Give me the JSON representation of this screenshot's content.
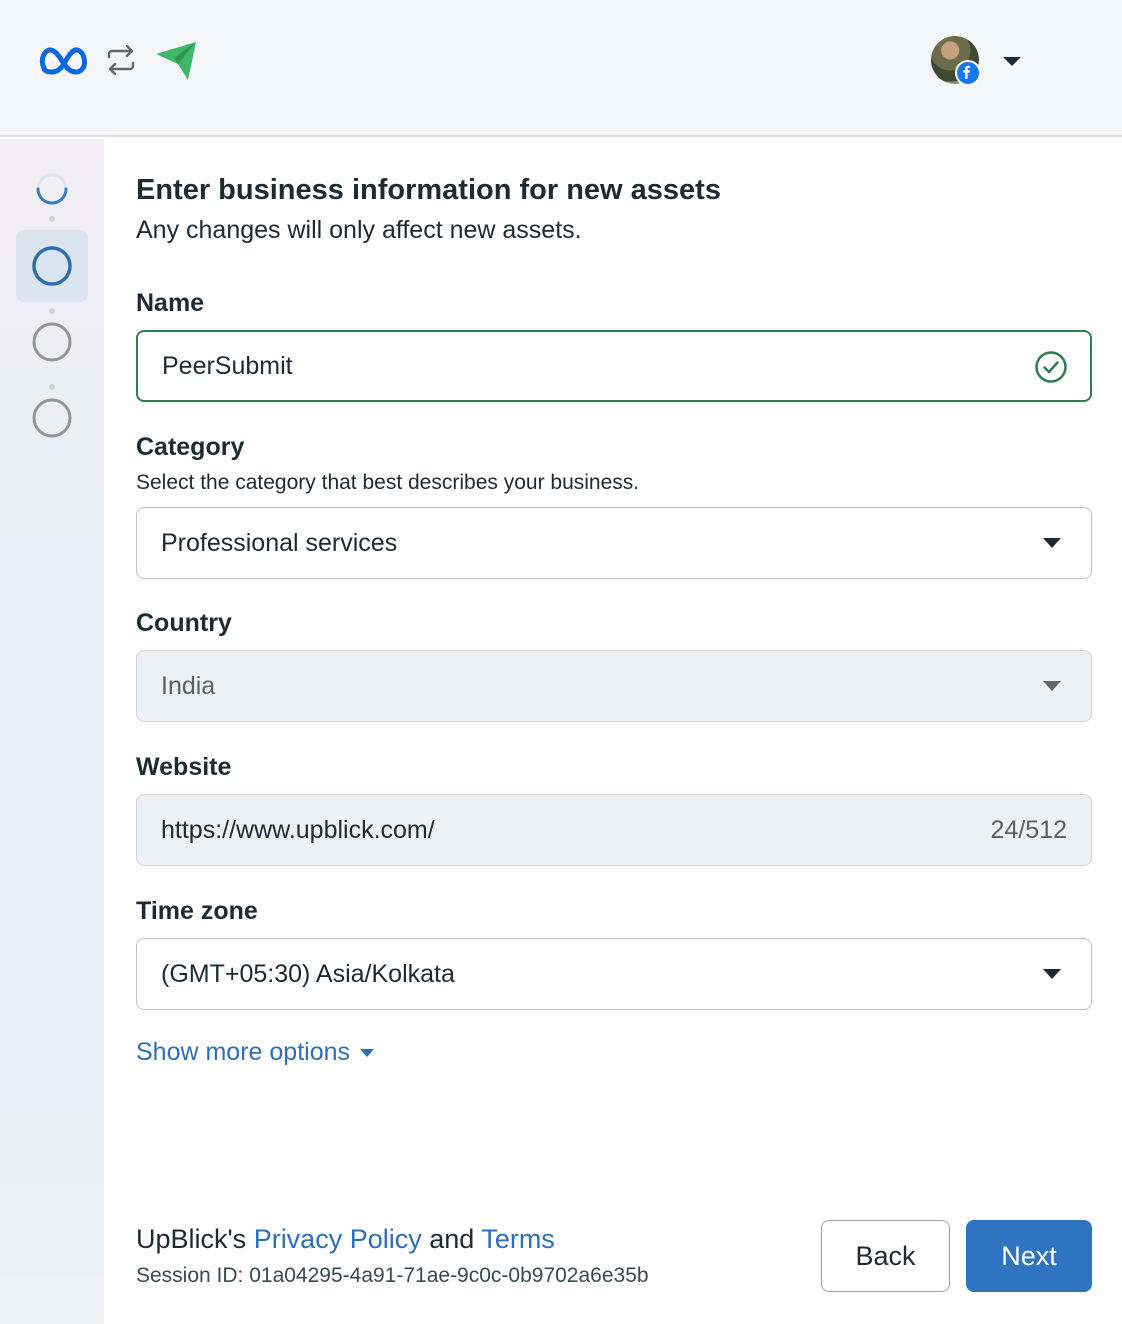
{
  "header": {
    "logos": [
      "meta-logo",
      "sync-icon",
      "app-logo"
    ],
    "account_menu_icon": "chevron-down-icon"
  },
  "stepper": {
    "steps": [
      "loading-step",
      "current-step",
      "pending-step",
      "pending-step"
    ]
  },
  "form": {
    "title": "Enter business information for new assets",
    "subtitle": "Any changes will only affect new assets.",
    "name": {
      "label": "Name",
      "value": "PeerSubmit"
    },
    "category": {
      "label": "Category",
      "helper": "Select the category that best describes your business.",
      "value": "Professional services"
    },
    "country": {
      "label": "Country",
      "value": "India"
    },
    "website": {
      "label": "Website",
      "value": "https://www.upblick.com/",
      "counter": "24/512"
    },
    "timezone": {
      "label": "Time zone",
      "value": "(GMT+05:30) Asia/Kolkata"
    },
    "show_more": "Show more options"
  },
  "footer": {
    "owner_prefix": "UpBlick's ",
    "privacy_link": "Privacy Policy",
    "and_text": " and ",
    "terms_link": "Terms",
    "session": "Session ID: 01a04295-4a91-71ae-9c0c-0b9702a6e35b",
    "back_label": "Back",
    "next_label": "Next"
  },
  "colors": {
    "accent": "#2f74c0",
    "link": "#2d6fb8",
    "valid": "#2f7d52",
    "meta_blue": "#0668e1",
    "app_green": "#3fb86a"
  }
}
